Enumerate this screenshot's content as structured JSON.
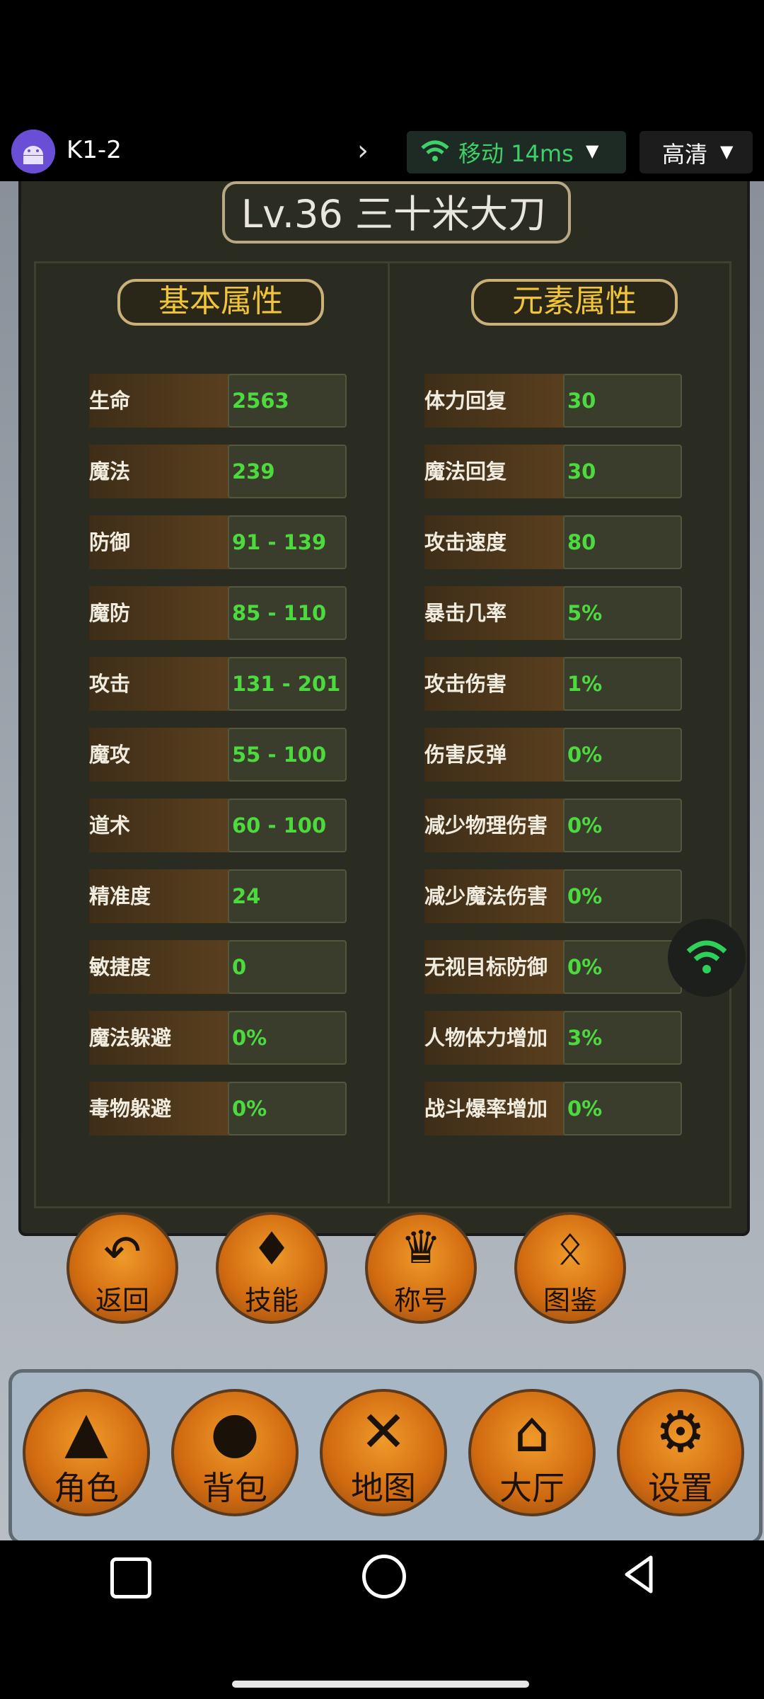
{
  "stream_bar": {
    "app_title": "K1-2",
    "network_label": "移动 14ms",
    "quality_label": "高清"
  },
  "character": {
    "title": "Lv.36 三十米大刀"
  },
  "sections": {
    "basic_title": "基本属性",
    "element_title": "元素属性"
  },
  "basic_stats": [
    {
      "label": "生命",
      "value": "2563"
    },
    {
      "label": "魔法",
      "value": "239"
    },
    {
      "label": "防御",
      "value": "91 - 139"
    },
    {
      "label": "魔防",
      "value": "85 - 110"
    },
    {
      "label": "攻击",
      "value": "131 - 201"
    },
    {
      "label": "魔攻",
      "value": "55 - 100"
    },
    {
      "label": "道术",
      "value": "60 - 100"
    },
    {
      "label": "精准度",
      "value": "24"
    },
    {
      "label": "敏捷度",
      "value": "0"
    },
    {
      "label": "魔法躲避",
      "value": "0%"
    },
    {
      "label": "毒物躲避",
      "value": "0%"
    }
  ],
  "element_stats": [
    {
      "label": "体力回复",
      "value": "30"
    },
    {
      "label": "魔法回复",
      "value": "30"
    },
    {
      "label": "攻击速度",
      "value": "80"
    },
    {
      "label": "暴击几率",
      "value": "5%"
    },
    {
      "label": "攻击伤害",
      "value": "1%"
    },
    {
      "label": "伤害反弹",
      "value": "0%"
    },
    {
      "label": "减少物理伤害",
      "value": "0%"
    },
    {
      "label": "减少魔法伤害",
      "value": "0%"
    },
    {
      "label": "无视目标防御",
      "value": "0%"
    },
    {
      "label": "人物体力增加",
      "value": "3%"
    },
    {
      "label": "战斗爆率增加",
      "value": "0%"
    }
  ],
  "panel_buttons": [
    {
      "label": "返回",
      "icon": "back-arrow-icon"
    },
    {
      "label": "技能",
      "icon": "skill-emblem-icon"
    },
    {
      "label": "称号",
      "icon": "crown-icon"
    },
    {
      "label": "图鉴",
      "icon": "dragon-icon"
    }
  ],
  "bottom_nav": [
    {
      "label": "角色",
      "icon": "wizard-icon"
    },
    {
      "label": "背包",
      "icon": "bag-icon"
    },
    {
      "label": "地图",
      "icon": "crossed-swords-icon"
    },
    {
      "label": "大厅",
      "icon": "house-icon"
    },
    {
      "label": "设置",
      "icon": "gears-icon"
    }
  ],
  "colors": {
    "stat_value": "#4dda3f",
    "section_title": "#f0c53a",
    "network": "#3fd06a"
  }
}
